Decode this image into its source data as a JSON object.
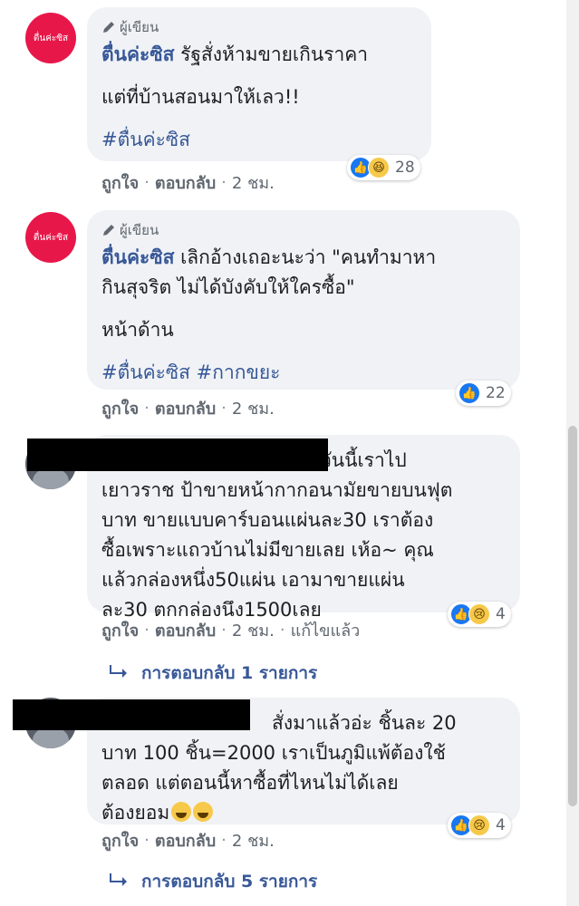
{
  "comments": [
    {
      "avatar_text": "ตื่นค่ะซิส",
      "badge": "ผู้เขียน",
      "name": "ตื่นค่ะซิส",
      "line1": " รัฐสั่งห้ามขายเกินราคา",
      "line2": "แต่ที่บ้านสอนมาให้เลว!!",
      "hashtags": "#ตื่นค่ะซิส",
      "like": "ถูกใจ",
      "reply": "ตอบกลับ",
      "time": "2 ชม.",
      "reaction_count": "28",
      "reaction_icons": [
        "like-icon",
        "haha-icon"
      ]
    },
    {
      "avatar_text": "ตื่นค่ะซิส",
      "badge": "ผู้เขียน",
      "name": "ตื่นค่ะซิส",
      "line1": " เลิกอ้างเถอะนะว่า \"คนทำมาหา",
      "line2": "กินสุจริต ไม่ได้บังคับให้ใครซื้อ\"",
      "para": "หน้าด้าน",
      "hashtags": "#ตื่นค่ะซิส #กากขยะ",
      "like": "ถูกใจ",
      "reply": "ตอบกลับ",
      "time": "2 ชม.",
      "reaction_count": "22",
      "reaction_icons": [
        "like-icon"
      ]
    },
    {
      "lines": [
        "วันนี้เราไป",
        "เยาวราช ป้าขายหน้ากากอนามัยขายบนฟุต",
        "บาท ขายแบบคาร์บอนแผ่นละ30 เราต้อง",
        "ซื้อเพราะแถวบ้านไม่มีขายเลย เห้อ~ คุณ",
        "แล้วกล่องหนึ่ง50แผ่น เอามาขายแผ่น",
        "ละ30 ตกกล่องนึง1500เลย"
      ],
      "like": "ถูกใจ",
      "reply": "ตอบกลับ",
      "time": "2 ชม.",
      "edited": "แก้ไขแล้ว",
      "reaction_count": "4",
      "reaction_icons": [
        "like-icon",
        "sad-icon"
      ],
      "replies_label": "การตอบกลับ 1 รายการ"
    },
    {
      "lines": [
        "สั่งมาแล้วอ่ะ ชิ้นละ 20",
        "บาท 100 ชิ้น=2000 เราเป็นภูมิแพ้ต้องใช้",
        "ตลอด แต่ตอนนี้หาซื้อที่ไหนไม่ได้เลย",
        "ต้องยอม"
      ],
      "like": "ถูกใจ",
      "reply": "ตอบกลับ",
      "time": "2 ชม.",
      "reaction_count": "4",
      "reaction_icons": [
        "like-icon",
        "sad-icon"
      ],
      "replies_label": "การตอบกลับ 5 รายการ"
    }
  ],
  "separator": "·",
  "colors": {
    "link": "#385898",
    "meta": "#606770",
    "bubble": "#f0f2f5",
    "brand_avatar": "#e8174a",
    "like_blue": "#1877f2",
    "emoji_yellow": "#f7c94a"
  }
}
